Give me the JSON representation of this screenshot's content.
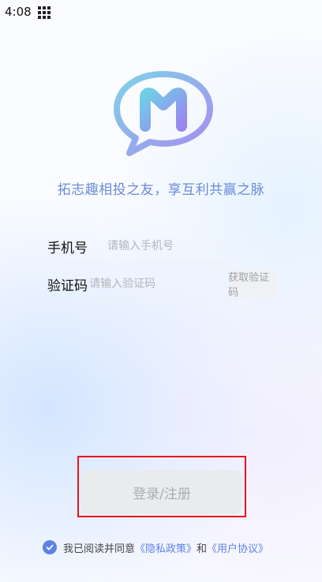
{
  "status_bar": {
    "time": "4:08"
  },
  "logo": {
    "letter": "M"
  },
  "slogan": "拓志趣相投之友，享互利共赢之脉",
  "form": {
    "phone": {
      "label": "手机号",
      "placeholder": "请输入手机号",
      "value": ""
    },
    "code": {
      "label": "验证码",
      "placeholder": "请输入验证码",
      "value": "",
      "get_code_label": "获取验证码"
    }
  },
  "login_button": "登录/注册",
  "agreement": {
    "checked": true,
    "prefix": "我已阅读并同意",
    "privacy_link": "《隐私政策》",
    "conjunction": "和",
    "user_link": "《用户协议》"
  },
  "colors": {
    "accent": "#5d82e6",
    "slogan": "#6a8bd8",
    "highlight": "#e8161b"
  }
}
